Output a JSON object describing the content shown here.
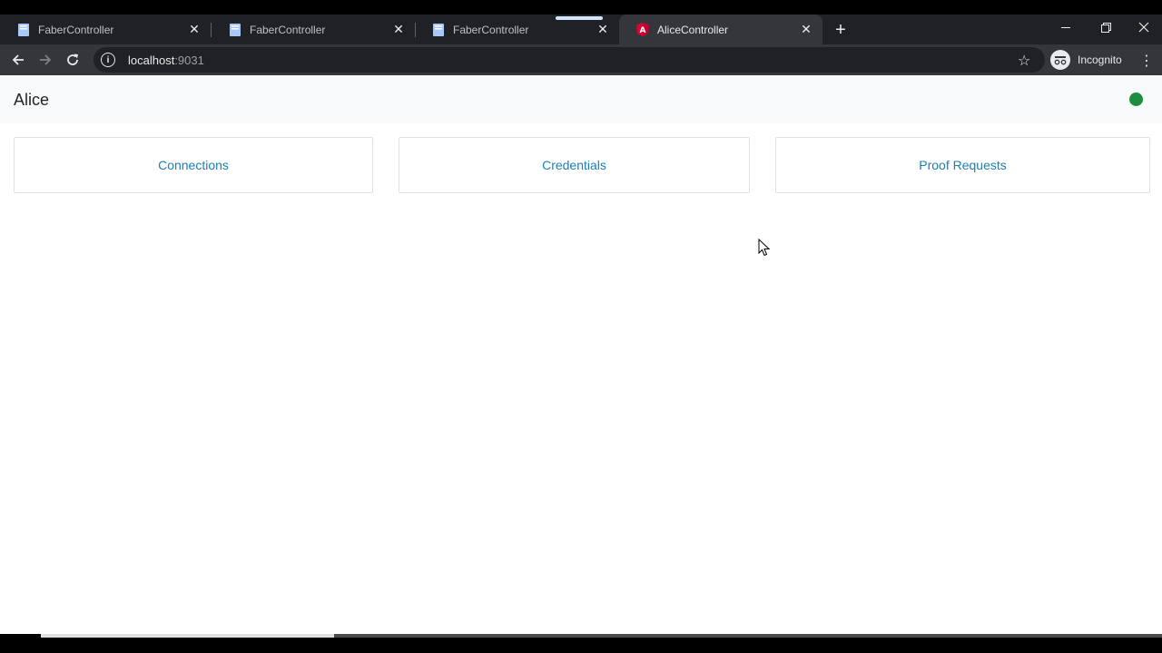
{
  "browser": {
    "tabs": [
      {
        "title": "FaberController"
      },
      {
        "title": "FaberController"
      },
      {
        "title": "FaberController"
      },
      {
        "title": "AliceController"
      }
    ],
    "url_host": "localhost",
    "url_port": ":9031",
    "profile_label": "Incognito"
  },
  "app": {
    "brand": "Alice",
    "status_color": "#1e8e3e",
    "cards": [
      {
        "label": "Connections"
      },
      {
        "label": "Credentials"
      },
      {
        "label": "Proof Requests"
      }
    ]
  },
  "colors": {
    "link": "#1a7fb4",
    "chrome_dark": "#202124",
    "chrome_toolbar": "#35363a"
  }
}
